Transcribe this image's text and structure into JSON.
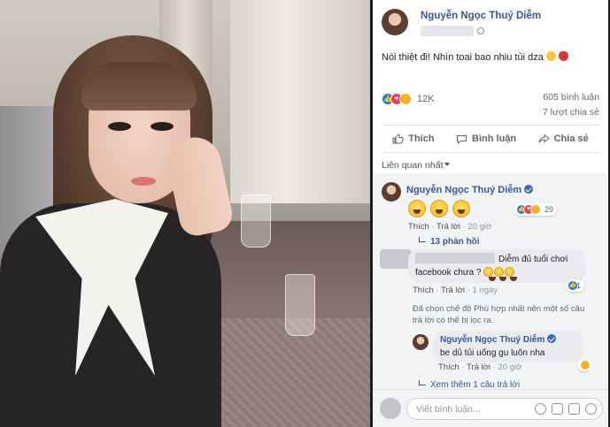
{
  "post": {
    "author": "Nguyễn Ngọc Thuý Diễm",
    "text": "Nói thiệt đi! Nhìn toai bao nhiu tủi dza",
    "reaction_count": "12K",
    "comment_count": "605 bình luận",
    "share_count": "7 lượt chia sẻ"
  },
  "actions": {
    "like": "Thích",
    "comment": "Bình luận",
    "share": "Chia sẻ"
  },
  "filter": {
    "label": "Liên quan nhất"
  },
  "comments": {
    "c1": {
      "author": "Nguyễn Ngọc Thuý Diễm",
      "reaction_count": "29",
      "like": "Thích",
      "reply": "Trả lời",
      "time": "20 giờ",
      "replies_link": "13 phản hồi"
    },
    "c2": {
      "line1": "Diễm đủ tuổi chơi",
      "line2": "facebook chưa ?",
      "reaction_count": "1",
      "like": "Thích",
      "reply": "Trả lời",
      "time": "1 ngày"
    },
    "notice": "Đã chọn chế độ Phù hợp nhất nên một số câu trả lời có thể bị lọc ra.",
    "c3": {
      "author": "Nguyễn Ngọc Thuý Diễm",
      "text": "be dủ tủi uống gu luôn nha",
      "like": "Thích",
      "reply": "Trả lời",
      "time": "20 giờ"
    },
    "more_replies": "Xem thêm 1 câu trả lời"
  },
  "composer": {
    "placeholder": "Viết bình luận..."
  },
  "colors": {
    "link": "#365899",
    "like_blue": "#1877f2",
    "love_red": "#f33e58",
    "haha_yellow": "#f7b125"
  }
}
